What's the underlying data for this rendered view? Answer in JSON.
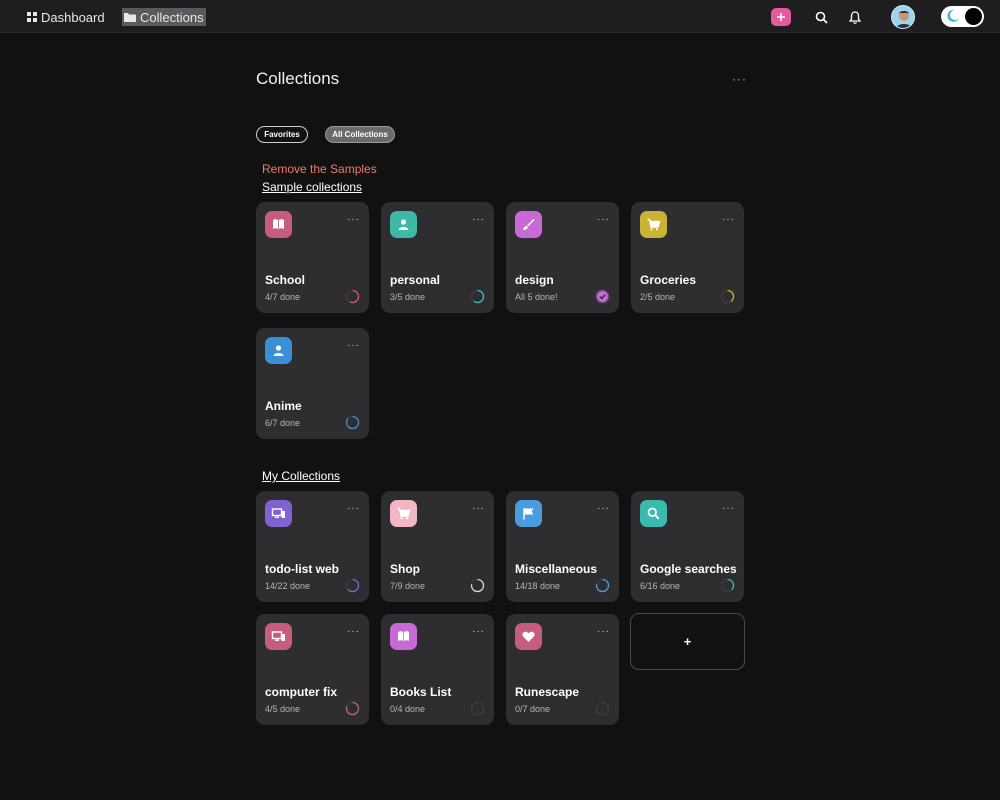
{
  "nav": {
    "dashboard_label": "Dashboard",
    "collections_label": "Collections",
    "add_icon": "plus-icon",
    "search_icon": "search-icon",
    "bell_icon": "bell-icon",
    "accent": "#e45aa0"
  },
  "page": {
    "title": "Collections",
    "menu": "···"
  },
  "filters": {
    "favorites": "Favorites",
    "all": "All Collections",
    "selected": "All Collections"
  },
  "sample": {
    "remove_label": "Remove the Samples",
    "section_title": "Sample collections",
    "cards": [
      {
        "name": "School",
        "progress": "4/7 done",
        "icon": "book-icon",
        "color": "#c75d7e",
        "ring": "#c75d7e",
        "fraction": 0.571
      },
      {
        "name": "personal",
        "progress": "3/5 done",
        "icon": "user-icon",
        "color": "#3fb8a8",
        "ring": "#3fb8c8",
        "fraction": 0.6
      },
      {
        "name": "design",
        "progress": "All 5 done!",
        "icon": "brush-icon",
        "color": "#c76ad6",
        "ring": "#c76ad6",
        "fraction": 1
      },
      {
        "name": "Groceries",
        "progress": "2/5 done",
        "icon": "cart-icon",
        "color": "#c9b334",
        "ring": "#c9b334",
        "fraction": 0.4
      },
      {
        "name": "Anime",
        "progress": "6/7 done",
        "icon": "user-icon",
        "color": "#3b8fd6",
        "ring": "#3b8fd6",
        "fraction": 0.857
      }
    ]
  },
  "mine": {
    "section_title": "My Collections",
    "cards": [
      {
        "name": "todo-list web",
        "progress": "14/22 done",
        "icon": "devices-icon",
        "color": "#8062d0",
        "ring": "#8062d0",
        "fraction": 0.636
      },
      {
        "name": "Shop",
        "progress": "7/9 done",
        "icon": "cart-icon",
        "color": "#f2b6c4",
        "ring": "#d8d8d8",
        "fraction": 0.778
      },
      {
        "name": "Miscellaneous",
        "progress": "14/18 done",
        "icon": "flag-icon",
        "color": "#4a9be0",
        "ring": "#4a9be0",
        "fraction": 0.778
      },
      {
        "name": "Google searches",
        "progress": "6/16 done",
        "icon": "search-icon",
        "color": "#3bbab0",
        "ring": "#3bbab0",
        "fraction": 0.375
      },
      {
        "name": "computer fix",
        "progress": "4/5 done",
        "icon": "devices-icon",
        "color": "#c75d7e",
        "ring": "#c75d7e",
        "fraction": 0.8
      },
      {
        "name": "Books List",
        "progress": "0/4 done",
        "icon": "book-icon",
        "color": "#c76ad6",
        "ring": "#555555",
        "fraction": 0
      },
      {
        "name": "Runescape",
        "progress": "0/7 done",
        "icon": "heart-icon",
        "color": "#c75d7e",
        "ring": "#555555",
        "fraction": 0
      }
    ],
    "add_label": "+"
  }
}
